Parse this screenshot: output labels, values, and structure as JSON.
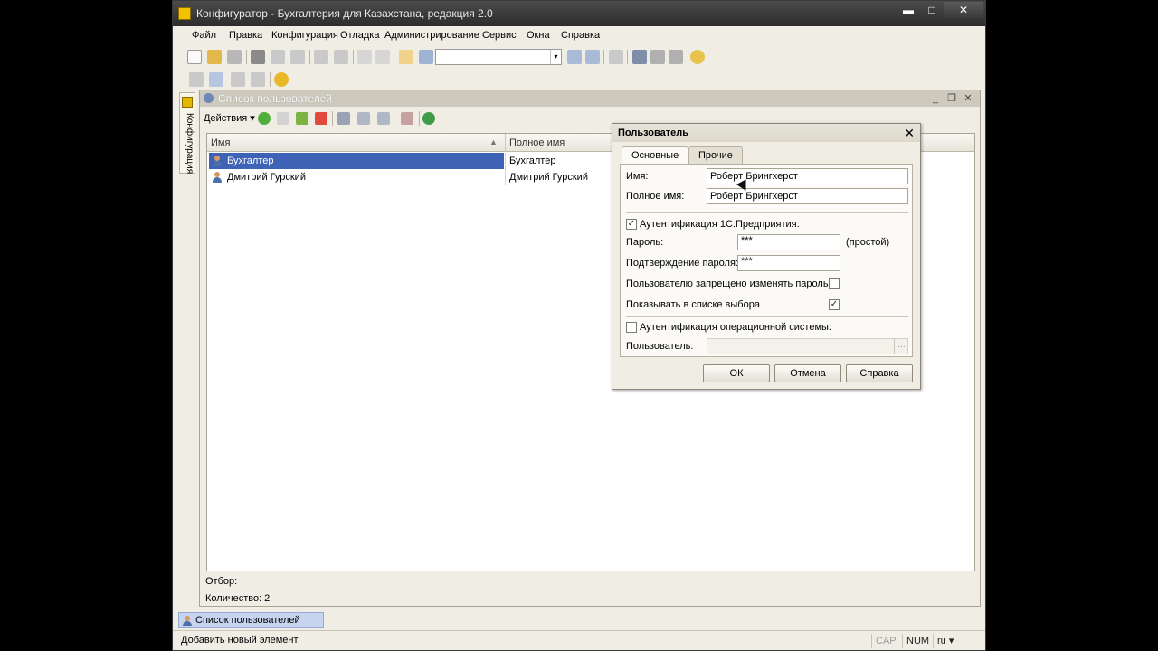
{
  "window": {
    "title": "Конфигуратор - Бухгалтерия для Казахстана, редакция 2.0",
    "minimize_glyph": "▬",
    "maximize_glyph": "□",
    "close_glyph": "✕"
  },
  "menu": [
    "Файл",
    "Правка",
    "Конфигурация",
    "Отладка",
    "Администрирование",
    "Сервис",
    "Окна",
    "Справка"
  ],
  "toolbar": {
    "search_value": "",
    "dropdown_glyph": "▾"
  },
  "side_panel": {
    "label": "Конфигурация"
  },
  "users_window": {
    "title": "Список пользователей",
    "actions_label": "Действия ▾",
    "minimize_glyph": "_",
    "restore_glyph": "❐",
    "close_glyph": "✕",
    "columns": [
      "Имя",
      "Полное имя"
    ],
    "sort_glyph": "▲",
    "rows": [
      {
        "name": "Бухгалтер",
        "full_name": "Бухгалтер",
        "selected": true
      },
      {
        "name": "Дмитрий Гурский",
        "full_name": "Дмитрий Гурский",
        "selected": false
      }
    ],
    "filter_label": "Отбор:",
    "count_label": "Количество: 2"
  },
  "taskbar": {
    "tab_label": "Список пользователей"
  },
  "status": {
    "text": "Добавить новый элемент",
    "cap": "CAP",
    "num": "NUM",
    "lang": "ru ▾"
  },
  "dialog": {
    "title": "Пользователь",
    "close_glyph": "✕",
    "tabs": [
      "Основные",
      "Прочие"
    ],
    "name_label": "Имя:",
    "name_value": "Роберт Брингхерст",
    "fullname_label": "Полное имя:",
    "fullname_value": "Роберт Брингхерст",
    "auth_1c_label": "Аутентификация 1С:Предприятия:",
    "auth_1c_checked": true,
    "password_label": "Пароль:",
    "password_value": "***",
    "password_hint": "(простой)",
    "confirm_label": "Подтверждение пароля:",
    "confirm_value": "***",
    "deny_change_label": "Пользователю запрещено изменять пароль",
    "deny_change_checked": false,
    "show_in_list_label": "Показывать в списке выбора",
    "show_in_list_checked": true,
    "auth_os_label": "Аутентификация операционной системы:",
    "auth_os_checked": false,
    "os_user_label": "Пользователь:",
    "os_user_value": "",
    "ellipsis": "...",
    "check_glyph": "✓",
    "buttons": {
      "ok": "ОК",
      "cancel": "Отмена",
      "help": "Справка"
    }
  },
  "colors": {
    "selection": "#3d62b6",
    "titlebar": "#2c2c2c",
    "window_bg": "#f0ede4"
  }
}
